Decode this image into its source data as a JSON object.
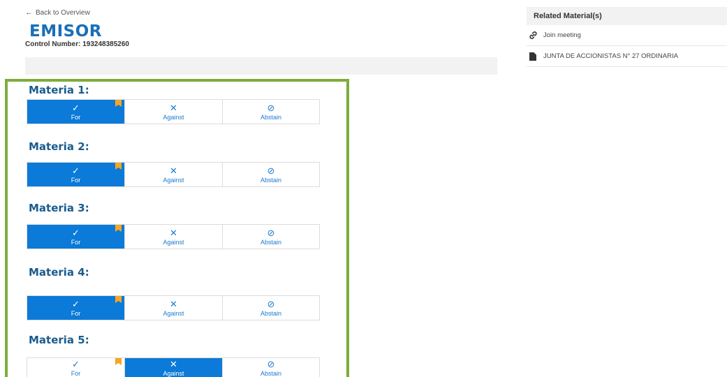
{
  "header": {
    "back_arrow": "←",
    "back_label": "Back to Overview",
    "title": "EMISOR",
    "control_number": "Control Number: 193248385260"
  },
  "vote_options": {
    "for_glyph": "✓",
    "against_glyph": "✕",
    "abstain_glyph": "⊘"
  },
  "materias": [
    {
      "label": "Materia 1:",
      "for": "For",
      "against": "Against",
      "abstain": "Abstain",
      "selected": "for"
    },
    {
      "label": "Materia 2:",
      "for": "For",
      "against": "Against",
      "abstain": "Abstain",
      "selected": "for"
    },
    {
      "label": "Materia 3:",
      "for": "For",
      "against": "Against",
      "abstain": "Abstain",
      "selected": "for"
    },
    {
      "label": "Materia 4:",
      "for": "For",
      "against": "Against",
      "abstain": "Abstain",
      "selected": "for"
    },
    {
      "label": "Materia 5:",
      "for": "For",
      "against": "Against",
      "abstain": "Abstain",
      "selected": "against"
    }
  ],
  "sidebar": {
    "header": "Related Material(s)",
    "items": [
      {
        "icon": "link-icon",
        "label": "Join meeting"
      },
      {
        "icon": "document-icon",
        "label": "JUNTA DE ACCIONISTAS N° 27 ORDINARIA"
      }
    ]
  },
  "colors": {
    "accent": "#0b7ad8",
    "title": "#1a6fb7",
    "highlight_border": "#7dad3b",
    "bookmark": "#f5a623"
  }
}
